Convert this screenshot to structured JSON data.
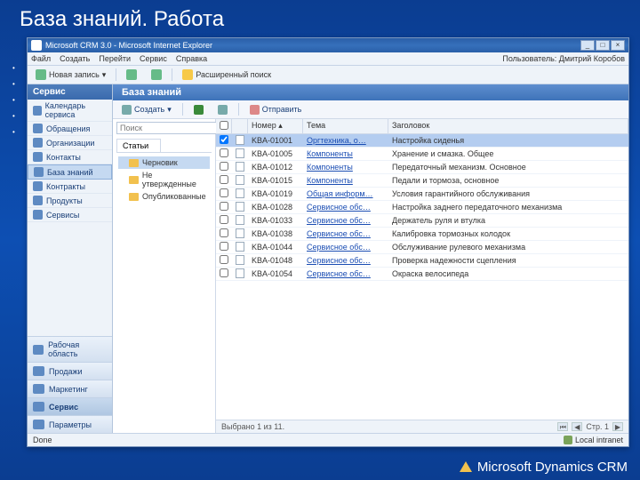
{
  "slide": {
    "title": "База знаний. Работа"
  },
  "window": {
    "title": "Microsoft CRM 3.0 - Microsoft Internet Explorer",
    "menus": [
      "Файл",
      "Создать",
      "Перейти",
      "Сервис",
      "Справка"
    ],
    "current_user_label": "Пользователь: Дмитрий Коробов",
    "toolbar": {
      "new_record": "Новая запись",
      "adv_search": "Расширенный поиск"
    }
  },
  "nav": {
    "header": "Сервис",
    "items": [
      {
        "label": "Календарь сервиса"
      },
      {
        "label": "Обращения"
      },
      {
        "label": "Организации"
      },
      {
        "label": "Контакты"
      },
      {
        "label": "База знаний",
        "selected": true
      },
      {
        "label": "Контракты"
      },
      {
        "label": "Продукты"
      },
      {
        "label": "Сервисы"
      }
    ],
    "modules": [
      {
        "label": "Рабочая область"
      },
      {
        "label": "Продажи"
      },
      {
        "label": "Маркетинг"
      },
      {
        "label": "Сервис",
        "active": true
      },
      {
        "label": "Параметры"
      }
    ]
  },
  "kb": {
    "header": "База знаний",
    "toolbar": {
      "create": "Создать",
      "send": "Отправить"
    },
    "search_placeholder": "Поиск",
    "tab": "Статьи",
    "tree": [
      {
        "label": "Черновик",
        "selected": true
      },
      {
        "label": "Не утвержденные"
      },
      {
        "label": "Опубликованные"
      }
    ],
    "columns": {
      "number": "Номер",
      "tema": "Тема",
      "zag": "Заголовок"
    },
    "rows": [
      {
        "num": "KBA-01001",
        "tema": "Оргтехника, о…",
        "zag": "Настройка сиденья",
        "selected": true
      },
      {
        "num": "KBA-01005",
        "tema": "Компоненты",
        "zag": "Хранение и смазка. Общее"
      },
      {
        "num": "KBA-01012",
        "tema": "Компоненты",
        "zag": "Передаточный механизм. Основное"
      },
      {
        "num": "KBA-01015",
        "tema": "Компоненты",
        "zag": "Педали и тормоза, основное"
      },
      {
        "num": "KBA-01019",
        "tema": "Общая информ…",
        "zag": "Условия гарантийного обслуживания"
      },
      {
        "num": "KBA-01028",
        "tema": "Сервисное обс…",
        "zag": "Настройка заднего передаточного механизма"
      },
      {
        "num": "KBA-01033",
        "tema": "Сервисное обс…",
        "zag": "Держатель руля и втулка"
      },
      {
        "num": "KBA-01038",
        "tema": "Сервисное обс…",
        "zag": "Калибровка тормозных колодок"
      },
      {
        "num": "KBA-01044",
        "tema": "Сервисное обс…",
        "zag": "Обслуживание рулевого механизма"
      },
      {
        "num": "KBA-01048",
        "tema": "Сервисное обс…",
        "zag": "Проверка надежности сцепления"
      },
      {
        "num": "KBA-01054",
        "tema": "Сервисное обс…",
        "zag": "Окраска велосипеда"
      }
    ],
    "status": "Выбрано 1 из 11.",
    "page_label": "Стр. 1"
  },
  "ie_status": {
    "done": "Done",
    "zone": "Local intranet"
  },
  "brand": "Microsoft Dynamics CRM"
}
